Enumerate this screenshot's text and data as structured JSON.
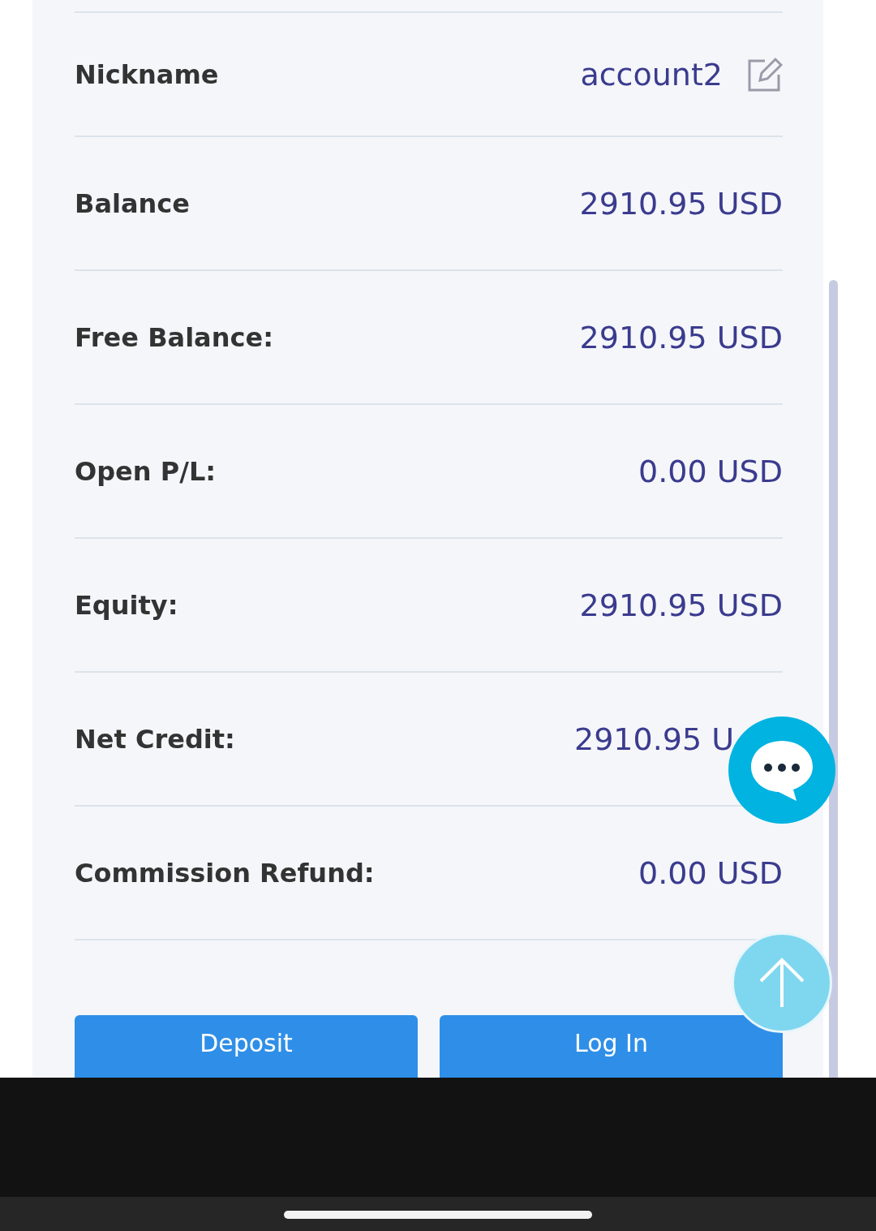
{
  "rows": [
    {
      "label": "Nickname",
      "value": "account2",
      "editable": true
    },
    {
      "label": "Balance",
      "value": "2910.95 USD"
    },
    {
      "label": "Free Balance:",
      "value": "2910.95 USD"
    },
    {
      "label": "Open P/L:",
      "value": "0.00 USD"
    },
    {
      "label": "Equity:",
      "value": "2910.95 USD"
    },
    {
      "label": "Net Credit:",
      "value": "2910.95 U",
      "obscured": true
    },
    {
      "label": "Commission Refund:",
      "value": "0.00 USD"
    }
  ],
  "buttons": [
    {
      "label": "Deposit"
    },
    {
      "label": "Log In"
    }
  ]
}
